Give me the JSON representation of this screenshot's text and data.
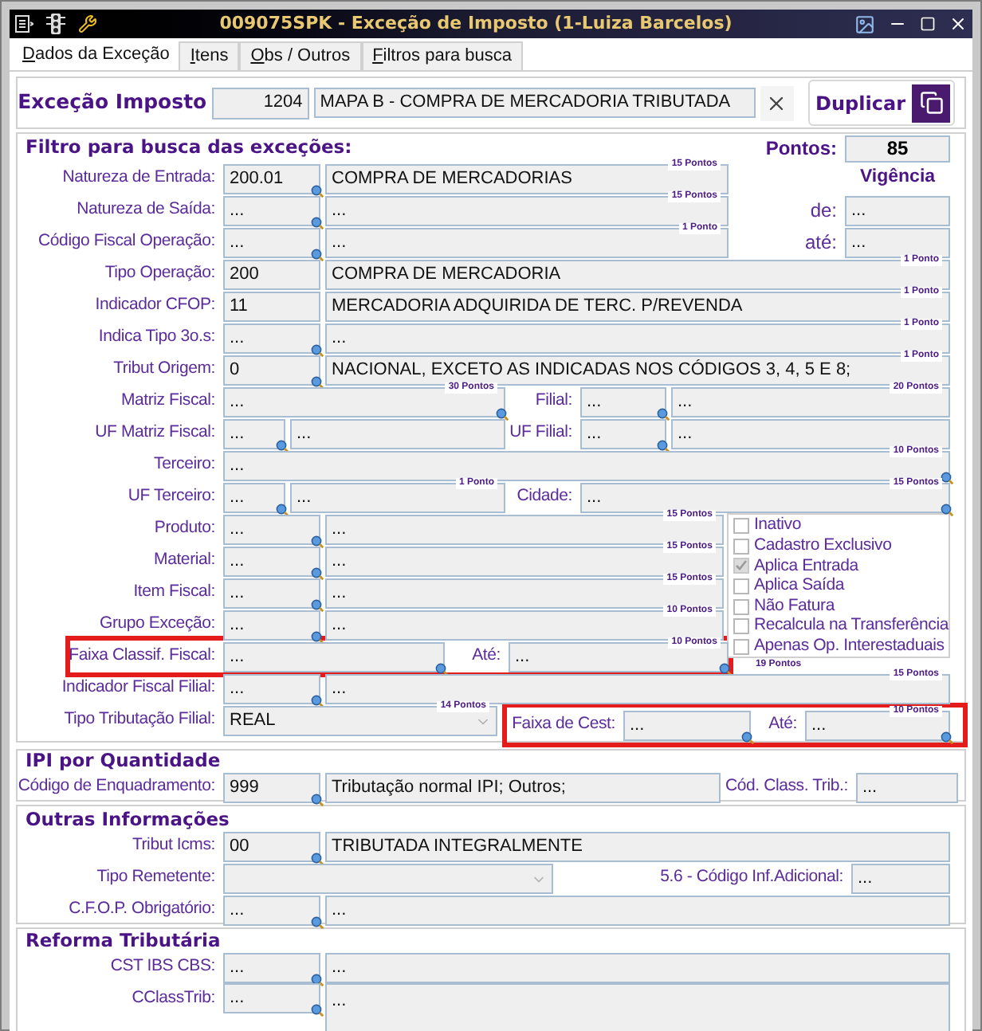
{
  "window": {
    "title": "009075SPK - Exceção de Imposto (1-Luiza Barcelos)"
  },
  "tabs": [
    {
      "label": "Dados da Exceção",
      "selected": true
    },
    {
      "label": "Itens",
      "selected": false
    },
    {
      "label": "Obs / Outros",
      "selected": false
    },
    {
      "label": "Filtros para busca",
      "selected": false
    }
  ],
  "header": {
    "label": "Exceção Imposto",
    "code": "1204",
    "description": "MAPA B - COMPRA DE MERCADORIA TRIBUTADA",
    "duplicate_button": "Duplicar"
  },
  "filter": {
    "title": "Filtro para busca das exceções:",
    "points_label": "Pontos:",
    "points": "85",
    "validity": {
      "title": "Vigência",
      "from_label": "de:",
      "from": "...",
      "to_label": "até:",
      "to": "..."
    },
    "rows": [
      {
        "label": "Natureza de Entrada:",
        "code": "200.01",
        "description": "COMPRA DE MERCADORIAS",
        "points": "15 Pontos"
      },
      {
        "label": "Natureza de Saída:",
        "code": "...",
        "description": "...",
        "points": "15 Pontos"
      },
      {
        "label": "Código Fiscal Operação:",
        "code": "...",
        "description": "...",
        "points": "1 Ponto"
      },
      {
        "label": "Tipo Operação:",
        "code": "200",
        "description": "COMPRA DE MERCADORIA",
        "points": "1 Ponto"
      },
      {
        "label": "Indicador CFOP:",
        "code": "11",
        "description": "MERCADORIA ADQUIRIDA DE TERC. P/REVENDA",
        "points": "1 Ponto"
      },
      {
        "label": "Indica Tipo 3o.s:",
        "code": "...",
        "description": "...",
        "points": "1 Ponto"
      },
      {
        "label": "Tribut Origem:",
        "code": "0",
        "description": "NACIONAL, EXCETO AS INDICADAS NOS CÓDIGOS 3, 4, 5 E 8;",
        "points": "1 Ponto"
      },
      {
        "label": "Matriz Fiscal:",
        "code": "...",
        "points": "30 Pontos",
        "side": {
          "label": "Filial:",
          "code": "...",
          "description": "...",
          "points": "20 Pontos"
        }
      },
      {
        "label": "UF Matriz Fiscal:",
        "code": "...",
        "description": "...",
        "side": {
          "label": "UF Filial:",
          "code": "...",
          "description": "..."
        }
      },
      {
        "label": "Terceiro:",
        "code": "...",
        "points": "10 Pontos"
      },
      {
        "label": "UF Terceiro:",
        "code": "...",
        "description": "...",
        "points": "1 Ponto",
        "side": {
          "label": "Cidade:",
          "code": "...",
          "points": "15 Pontos"
        }
      },
      {
        "label": "Produto:",
        "code": "...",
        "description": "...",
        "points": "15 Pontos"
      },
      {
        "label": "Material:",
        "code": "...",
        "description": "...",
        "points": "15 Pontos"
      },
      {
        "label": "Item Fiscal:",
        "code": "...",
        "description": "...",
        "points": "15 Pontos"
      },
      {
        "label": "Grupo Exceção:",
        "code": "...",
        "description": "...",
        "points": "10 Pontos"
      },
      {
        "label": "Faixa Classif. Fiscal:",
        "code": "...",
        "highlighted": true,
        "side": {
          "label": "Até:",
          "code": "...",
          "points": "10 Pontos"
        }
      },
      {
        "label": "Indicador Fiscal Filial:",
        "code": "...",
        "description": "...",
        "points": "15 Pontos"
      },
      {
        "label": "Tipo Tributação Filial:",
        "code": "REAL",
        "points": "14 Pontos",
        "side": {
          "label": "Faixa de Cest:",
          "code": "...",
          "highlighted": true,
          "to_label": "Até:",
          "to": "...",
          "points": "10 Pontos"
        }
      }
    ],
    "checkboxes": [
      {
        "label": "Inativo",
        "checked": false,
        "disabled": false
      },
      {
        "label": "Cadastro Exclusivo",
        "checked": false,
        "disabled": false
      },
      {
        "label": "Aplica Entrada",
        "checked": true,
        "disabled": true
      },
      {
        "label": "Aplica Saída",
        "checked": false,
        "disabled": false
      },
      {
        "label": "Não Fatura",
        "checked": false,
        "disabled": false
      },
      {
        "label": "Recalcula na Transferência",
        "checked": false,
        "disabled": false
      },
      {
        "label": "Apenas Op. Interestaduais",
        "checked": false,
        "disabled": false
      }
    ],
    "checkbox_points": "19 Pontos"
  },
  "ipi": {
    "title": "IPI por Quantidade",
    "label": "Código de Enquadramento:",
    "code": "999",
    "description": "Tributação normal IPI; Outros;",
    "class_label": "Cód. Class. Trib.:",
    "class_value": "..."
  },
  "other_info": {
    "title": "Outras Informações",
    "rows": [
      {
        "label": "Tribut Icms:",
        "code": "00",
        "description": "TRIBUTADA INTEGRALMENTE"
      },
      {
        "label": "Tipo Remetente:",
        "side_label": "5.6 - Código Inf.Adicional:",
        "side_value": "..."
      },
      {
        "label": "C.F.O.P. Obrigatório:",
        "code": "...",
        "description": "..."
      }
    ]
  },
  "tax_reform": {
    "title": "Reforma Tributária",
    "rows": [
      {
        "label": "CST IBS CBS:",
        "code": "...",
        "description": "..."
      },
      {
        "label": "CClassTrib:",
        "code": "...",
        "description": "..."
      }
    ]
  }
}
